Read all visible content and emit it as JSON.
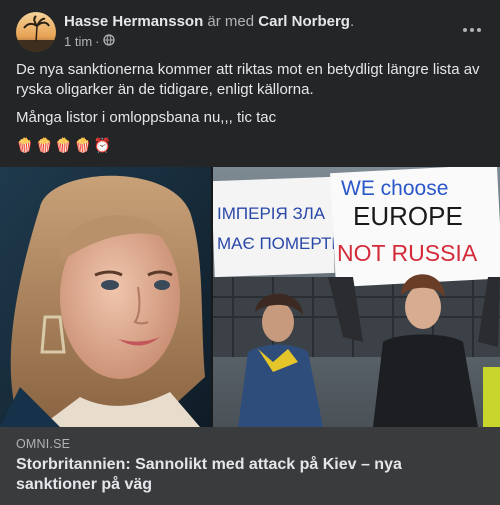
{
  "post": {
    "author": "Hasse Hermansson",
    "with_text": "är med",
    "tagged": "Carl Norberg",
    "period": ".",
    "time": "1 tim",
    "dot": "·",
    "privacy_icon": "globe-icon",
    "more_icon": "more-horizontal-icon",
    "paragraph1": "De nya sanktionerna kommer att riktas mot en betydligt längre lista av ryska oligarker än de tidigare, enligt källorna.",
    "paragraph2": "Många listor i omloppsbana nu,,, tic tac",
    "emojis": [
      "🍿",
      "🍿",
      "🍿",
      "🍿",
      "⏰"
    ]
  },
  "media": {
    "right_sign_top": [
      "ІМПЕРІЯ ЗЛА",
      "МАЄ ПОМЕРТИ"
    ],
    "right_sign_main": [
      "WE choose",
      "EUROPE",
      "NOT RUSSIA"
    ]
  },
  "link": {
    "domain": "OMNI.SE",
    "title": "Storbritannien: Sannolikt med attack på Kiev – nya sanktioner på väg"
  },
  "colors": {
    "background": "#242526",
    "card": "#3a3b3c",
    "text": "#e4e6eb",
    "muted": "#b0b3b8"
  }
}
